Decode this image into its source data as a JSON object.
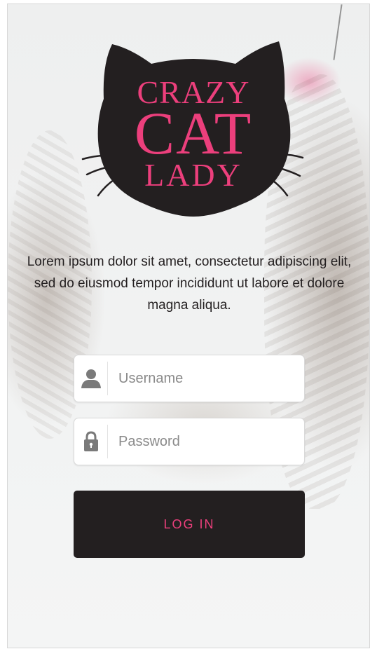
{
  "brand": {
    "line1": "CRAZY",
    "line2": "CAT",
    "line3": "LADY",
    "accent_color": "#ec3f7c",
    "logo_color": "#231f20"
  },
  "tagline": "Lorem ipsum dolor sit amet, consectetur adipiscing elit, sed do eiusmod tempor incididunt ut labore et dolore magna aliqua.",
  "form": {
    "username": {
      "placeholder": "Username",
      "value": "",
      "icon": "user-icon"
    },
    "password": {
      "placeholder": "Password",
      "value": "",
      "icon": "lock-icon"
    },
    "login_label": "LOG IN"
  }
}
